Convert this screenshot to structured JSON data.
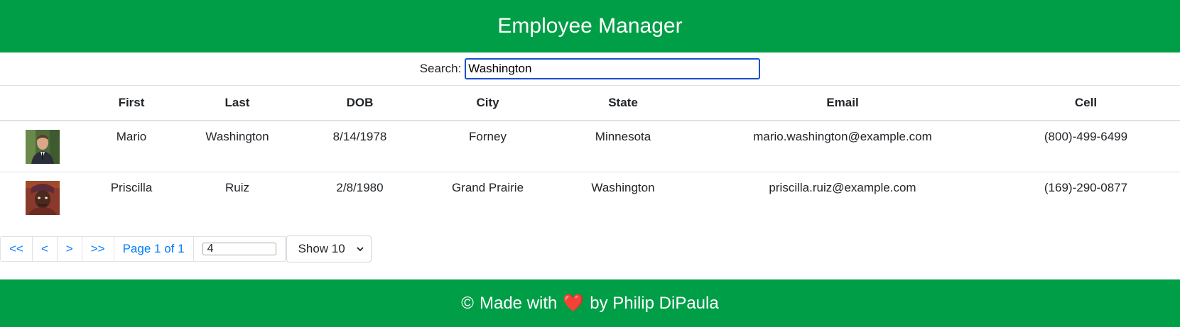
{
  "header": {
    "title": "Employee Manager"
  },
  "search": {
    "label": "Search:",
    "value": "Washington"
  },
  "table": {
    "columns": [
      "",
      "First",
      "Last",
      "DOB",
      "City",
      "State",
      "Email",
      "Cell"
    ],
    "rows": [
      {
        "first": "Mario",
        "last": "Washington",
        "dob": "8/14/1978",
        "city": "Forney",
        "state": "Minnesota",
        "email": "mario.washington@example.com",
        "cell": "(800)-499-6499"
      },
      {
        "first": "Priscilla",
        "last": "Ruiz",
        "dob": "2/8/1980",
        "city": "Grand Prairie",
        "state": "Washington",
        "email": "priscilla.ruiz@example.com",
        "cell": "(169)-290-0877"
      }
    ]
  },
  "pager": {
    "first": "<<",
    "prev": "<",
    "next": ">",
    "last": ">>",
    "page_info": "Page 1 of 1",
    "page_input_value": "4",
    "show_value": "Show 10"
  },
  "footer": {
    "copyright": "©",
    "made_with": "Made with",
    "heart": "❤️",
    "by": "by Philip DiPaula"
  },
  "colors": {
    "brand_green": "#009e47",
    "link_blue": "#007bff",
    "focus_blue": "#1a4fd1"
  }
}
